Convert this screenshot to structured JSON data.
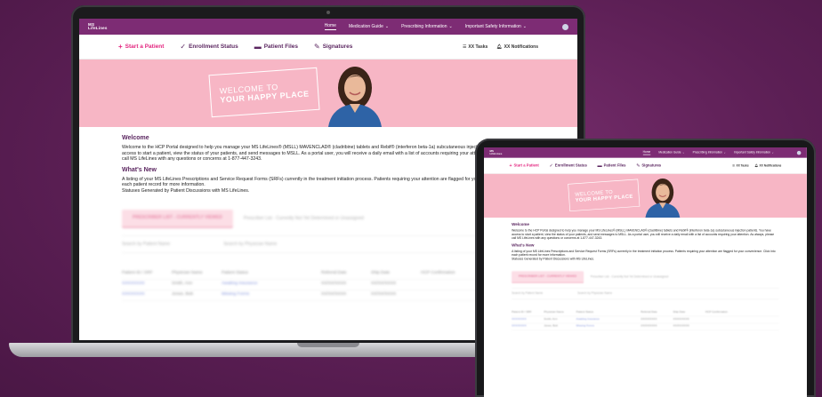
{
  "portal": {
    "logo_line1": "MS",
    "logo_line2": "LifeLines",
    "nav": [
      {
        "label": "Home",
        "active": true
      },
      {
        "label": "Medication Guide",
        "dropdown": true
      },
      {
        "label": "Prescribing Information",
        "dropdown": true
      },
      {
        "label": "Important Safety Information",
        "dropdown": true
      }
    ],
    "toolbar": {
      "start": "Start a Patient",
      "enrollment": "Enrollment Status",
      "files": "Patient Files",
      "signatures": "Signatures",
      "tasks": "XX Tasks",
      "notifications": "XX Notifications"
    },
    "hero": {
      "line1": "WELCOME TO",
      "line2": "YOUR HAPPY PLACE"
    },
    "welcome": {
      "heading": "Welcome",
      "body": "Welcome to the HCP Portal designed to help you manage your MS LifeLines® (MSLL) MAVENCLAD® (cladribine) tablets and Rebif® (interferon beta-1a) subcutaneous injection patients. You have access to start a patient, view the status of your patients, and send messages to MSLL. As a portal user, you will receive a daily email with a list of accounts requiring your attention. As always, please call MS LifeLines with any questions or concerns at 1-877-447-3243."
    },
    "whats_new": {
      "heading": "What's New",
      "body": "A listing of your MS LifeLines Prescriptions and Service Request Forms (SRFs) currently in the treatment initiation process. Patients requiring your attention are flagged for your convenience. Click into each patient record for more information.",
      "sub": "Statuses Generated by Patient Discussions with MS LifeLines."
    },
    "tabs": {
      "active": "PRESCRIBER LIST - CURRENTLY VIEWED",
      "inactive": "Prescriber List - Currently Not Yet Determined or Unassigned"
    },
    "search": {
      "patient": "Search by Patient Name",
      "physician": "Search by Physician Name"
    },
    "table": {
      "headers": [
        "Patient ID / SRF",
        "Physician Name",
        "Patient Status",
        "",
        "Referral Date",
        "Ship Date",
        "HCP Confirmation"
      ],
      "rows": [
        [
          "XXXXXXXX",
          "Smith, Ann",
          "Awaiting Insurance",
          "",
          "XX/XX/XXXX",
          "XX/XX/XXXX",
          ""
        ],
        [
          "XXXXXXXX",
          "Jones, Bob",
          "Missing Forms",
          "",
          "XX/XX/XXXX",
          "XX/XX/XXXX",
          ""
        ]
      ]
    }
  }
}
